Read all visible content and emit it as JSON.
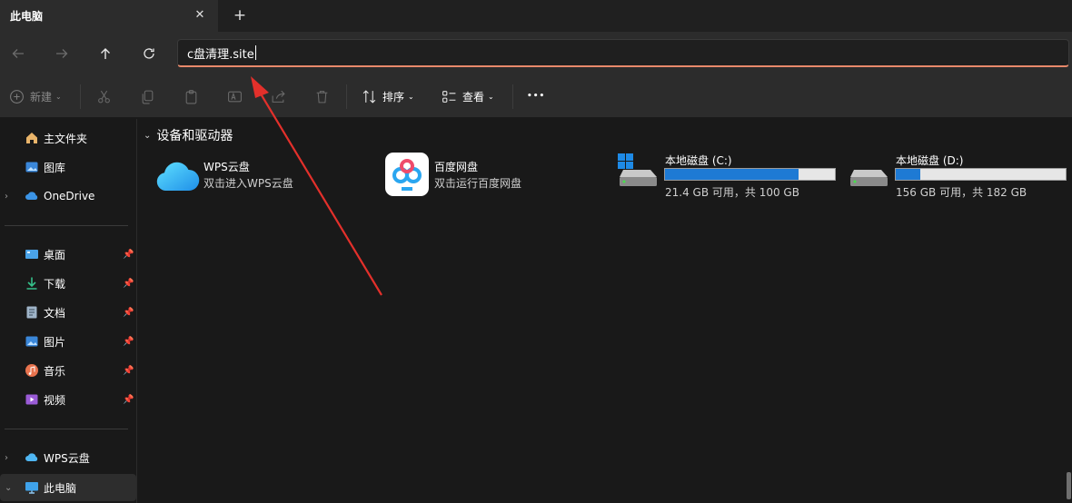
{
  "tab": {
    "title": "此电脑",
    "close_glyph": "✕",
    "add_glyph": "+"
  },
  "address": {
    "value": "c盘清理.site"
  },
  "toolbar": {
    "new_label": "新建",
    "sort_label": "排序",
    "view_label": "查看",
    "more_glyph": "•••"
  },
  "sidebar": {
    "items": [
      {
        "label": "主文件夹",
        "icon": "home-icon"
      },
      {
        "label": "图库",
        "icon": "gallery-icon"
      },
      {
        "label": "OneDrive",
        "icon": "onedrive-icon"
      },
      {
        "label": "桌面",
        "icon": "desktop-icon"
      },
      {
        "label": "下载",
        "icon": "download-icon"
      },
      {
        "label": "文档",
        "icon": "document-icon"
      },
      {
        "label": "图片",
        "icon": "pictures-icon"
      },
      {
        "label": "音乐",
        "icon": "music-icon"
      },
      {
        "label": "视频",
        "icon": "video-icon"
      },
      {
        "label": "WPS云盘",
        "icon": "wps-cloud-icon"
      },
      {
        "label": "此电脑",
        "icon": "this-pc-icon"
      }
    ]
  },
  "content": {
    "section_title": "设备和驱动器",
    "tiles": [
      {
        "name": "WPS云盘",
        "sub": "双击进入WPS云盘"
      },
      {
        "name": "百度网盘",
        "sub": "双击运行百度网盘"
      }
    ],
    "drives": [
      {
        "name": "本地磁盘 (C:)",
        "sub": "21.4 GB 可用，共 100 GB",
        "used_fraction": 0.786
      },
      {
        "name": "本地磁盘 (D:)",
        "sub": "156 GB 可用，共 182 GB",
        "used_fraction": 0.143
      }
    ]
  },
  "colors": {
    "accent": "#1e7ad4",
    "arrow": "#e3302b",
    "address_underline": "#e8896b"
  }
}
